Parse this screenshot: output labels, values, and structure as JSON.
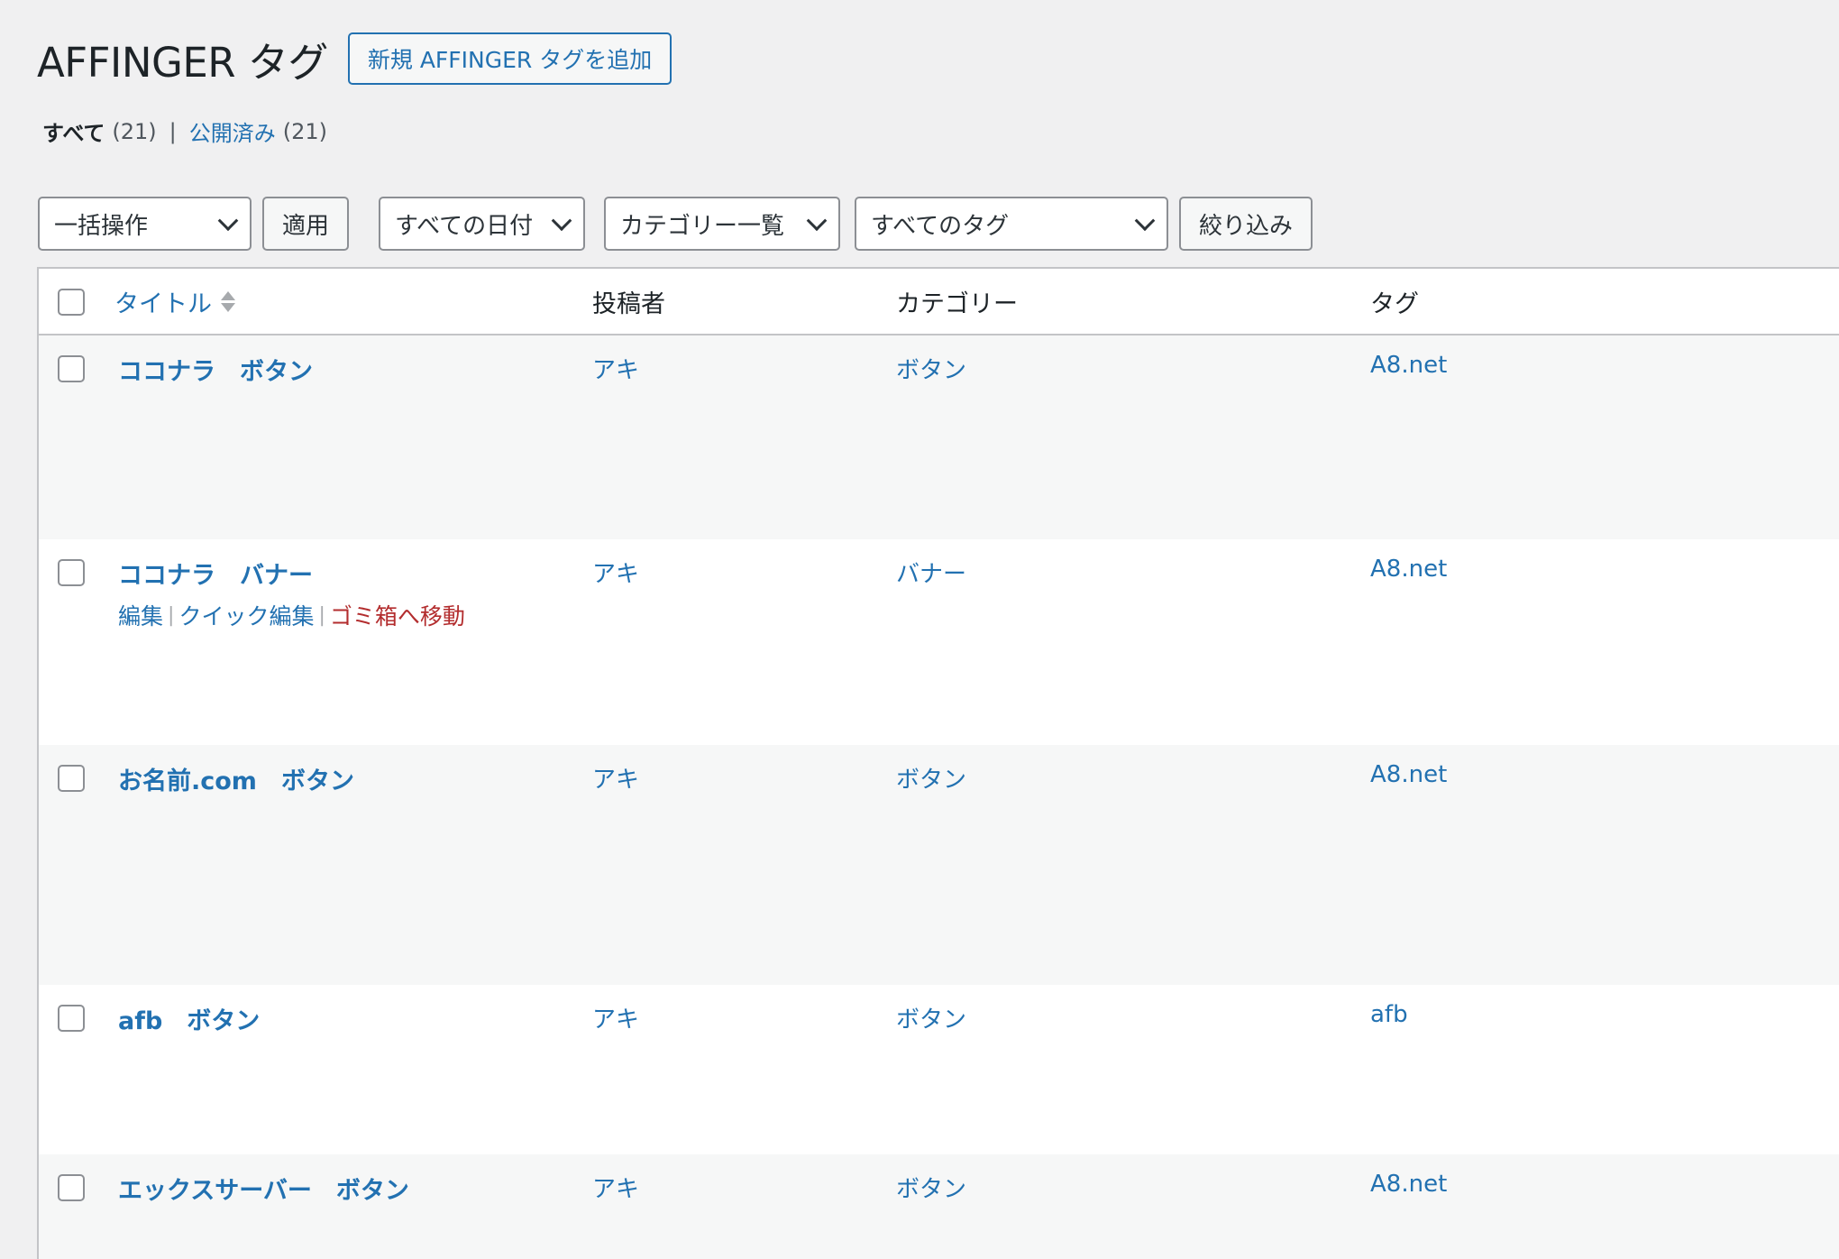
{
  "header": {
    "title": "AFFINGER タグ",
    "add_new_label": "新規 AFFINGER タグを追加"
  },
  "views": {
    "all_label": "すべて",
    "all_count": "(21)",
    "separator": "|",
    "published_label": "公開済み",
    "published_count": "(21)"
  },
  "tablenav": {
    "bulk_action": "一括操作",
    "apply": "適用",
    "dates": "すべての日付",
    "categories": "カテゴリー一覧",
    "tags": "すべてのタグ",
    "filter": "絞り込み"
  },
  "columns": {
    "title": "タイトル",
    "author": "投稿者",
    "category": "カテゴリー",
    "tag": "タグ"
  },
  "rows": [
    {
      "title": "ココナラ　ボタン",
      "author": "アキ",
      "category": "ボタン",
      "tag": "A8.net"
    },
    {
      "title": "ココナラ　バナー",
      "author": "アキ",
      "category": "バナー",
      "tag": "A8.net"
    },
    {
      "title": "お名前.com　ボタン",
      "author": "アキ",
      "category": "ボタン",
      "tag": "A8.net"
    },
    {
      "title": "afb　ボタン",
      "author": "アキ",
      "category": "ボタン",
      "tag": "afb"
    },
    {
      "title": "エックスサーバー　ボタン",
      "author": "アキ",
      "category": "ボタン",
      "tag": "A8.net"
    }
  ],
  "row_actions": {
    "edit": "編集",
    "quick_edit": "クイック編集",
    "trash": "ゴミ箱へ移動",
    "separator": "|"
  }
}
